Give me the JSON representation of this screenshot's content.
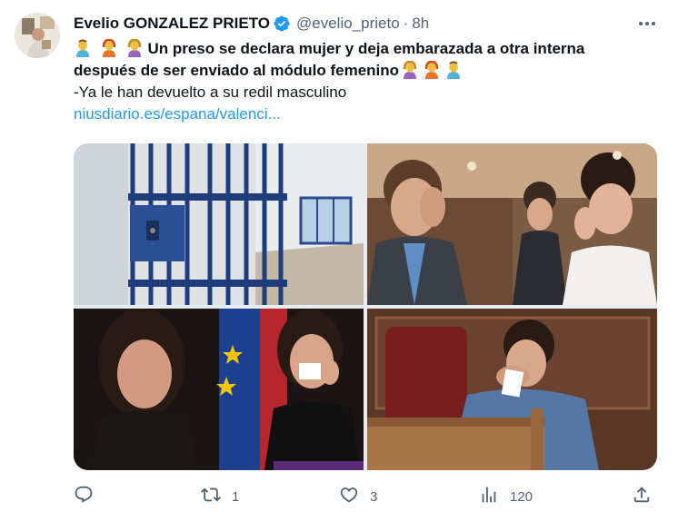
{
  "tweet": {
    "author": {
      "display_name": "Evelio GONZALEZ PRIETO",
      "handle": "@evelio_prieto",
      "verified": true,
      "verified_color": "#1d9bf0"
    },
    "separator": "·",
    "time": "8h",
    "text": {
      "headline": "Un preso se declara mujer y deja embarazada a otra interna",
      "headline_line2": "después de ser enviado al módulo femenino",
      "body": "-Ya le han devuelto a su redil masculino",
      "link": "niusdiario.es/espana/valenci..."
    },
    "emojis_leading": [
      "man-facepalming-emoji",
      "woman-facepalming-emoji",
      "woman-facepalming-emoji"
    ],
    "emojis_trailing": [
      "woman-facepalming-emoji",
      "woman-facepalming-emoji",
      "man-facepalming-emoji"
    ],
    "media": [
      {
        "name": "prison-cell-photo"
      },
      {
        "name": "politician-wiping-eye-photo"
      },
      {
        "name": "woman-crying-flags-photo"
      },
      {
        "name": "man-crying-in-parliament-photo"
      }
    ],
    "actions": {
      "reply_count": "",
      "retweet_count": "1",
      "like_count": "3",
      "views_count": "120"
    },
    "colors": {
      "text": "#0f1419",
      "secondary": "#536471",
      "link": "#1d9bf0"
    }
  }
}
